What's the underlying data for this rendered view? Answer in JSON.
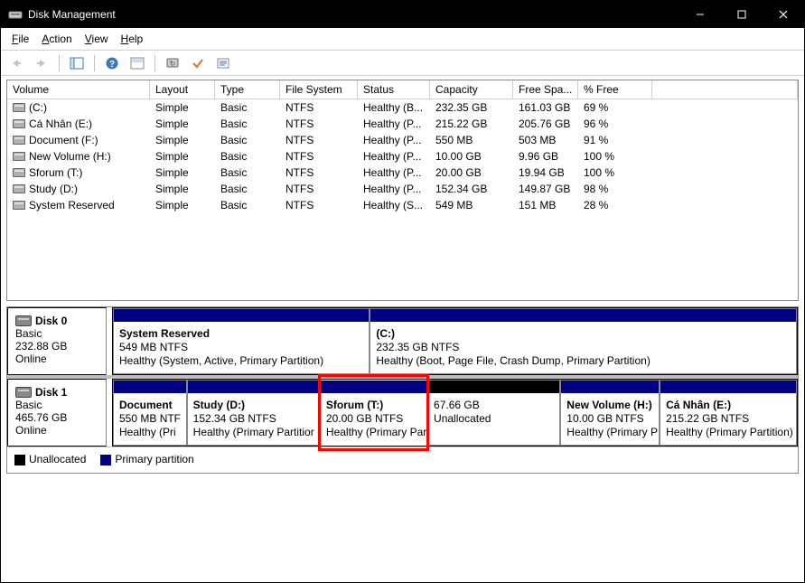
{
  "window": {
    "title": "Disk Management"
  },
  "menu": {
    "file": "File",
    "action": "Action",
    "view": "View",
    "help": "Help"
  },
  "table": {
    "headers": [
      "Volume",
      "Layout",
      "Type",
      "File System",
      "Status",
      "Capacity",
      "Free Spa...",
      "% Free"
    ],
    "rows": [
      {
        "vol": "(C:)",
        "layout": "Simple",
        "type": "Basic",
        "fs": "NTFS",
        "status": "Healthy (B...",
        "cap": "232.35 GB",
        "free": "161.03 GB",
        "pct": "69 %"
      },
      {
        "vol": "Cá Nhân (E:)",
        "layout": "Simple",
        "type": "Basic",
        "fs": "NTFS",
        "status": "Healthy (P...",
        "cap": "215.22 GB",
        "free": "205.76 GB",
        "pct": "96 %"
      },
      {
        "vol": "Document (F:)",
        "layout": "Simple",
        "type": "Basic",
        "fs": "NTFS",
        "status": "Healthy (P...",
        "cap": "550 MB",
        "free": "503 MB",
        "pct": "91 %"
      },
      {
        "vol": "New Volume (H:)",
        "layout": "Simple",
        "type": "Basic",
        "fs": "NTFS",
        "status": "Healthy (P...",
        "cap": "10.00 GB",
        "free": "9.96 GB",
        "pct": "100 %"
      },
      {
        "vol": "Sforum (T:)",
        "layout": "Simple",
        "type": "Basic",
        "fs": "NTFS",
        "status": "Healthy (P...",
        "cap": "20.00 GB",
        "free": "19.94 GB",
        "pct": "100 %"
      },
      {
        "vol": "Study (D:)",
        "layout": "Simple",
        "type": "Basic",
        "fs": "NTFS",
        "status": "Healthy (P...",
        "cap": "152.34 GB",
        "free": "149.87 GB",
        "pct": "98 %"
      },
      {
        "vol": "System Reserved",
        "layout": "Simple",
        "type": "Basic",
        "fs": "NTFS",
        "status": "Healthy (S...",
        "cap": "549 MB",
        "free": "151 MB",
        "pct": "28 %"
      }
    ]
  },
  "disks": [
    {
      "name": "Disk 0",
      "type": "Basic",
      "size": "232.88 GB",
      "state": "Online",
      "parts": [
        {
          "title": "System Reserved",
          "line": "549 MB NTFS",
          "status": "Healthy (System, Active, Primary Partition)",
          "kind": "primary",
          "flex": 1.2
        },
        {
          "title": "(C:)",
          "line": "232.35 GB NTFS",
          "status": "Healthy (Boot, Page File, Crash Dump, Primary Partition)",
          "kind": "primary",
          "flex": 2
        }
      ]
    },
    {
      "name": "Disk 1",
      "type": "Basic",
      "size": "465.76 GB",
      "state": "Online",
      "parts": [
        {
          "title": "Document",
          "line": "550 MB NTF",
          "status": "Healthy (Pri",
          "kind": "primary",
          "flex": 0.85
        },
        {
          "title": "Study  (D:)",
          "line": "152.34 GB NTFS",
          "status": "Healthy (Primary Partitior",
          "kind": "primary",
          "flex": 1.55
        },
        {
          "title": "Sforum  (T:)",
          "line": "20.00 GB NTFS",
          "status": "Healthy (Primary Par",
          "kind": "primary",
          "flex": 1.25,
          "highlight": true
        },
        {
          "title": "",
          "line": "67.66 GB",
          "status": "Unallocated",
          "kind": "unalloc",
          "flex": 1.55
        },
        {
          "title": "New Volume  (H:)",
          "line": "10.00 GB NTFS",
          "status": "Healthy (Primary P",
          "kind": "primary",
          "flex": 1.15
        },
        {
          "title": "Cá Nhân  (E:)",
          "line": "215.22 GB NTFS",
          "status": "Healthy (Primary Partition)",
          "kind": "primary",
          "flex": 1.6
        }
      ]
    }
  ],
  "legend": {
    "unallocated": "Unallocated",
    "primary": "Primary partition"
  }
}
